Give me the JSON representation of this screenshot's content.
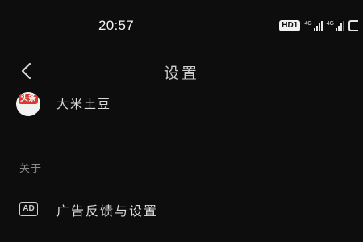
{
  "status_bar": {
    "time": "20:57",
    "hd_badge": "HD1",
    "network_1": "4G",
    "network_2": "4G"
  },
  "header": {
    "title": "设置",
    "back_icon": "chevron-left-icon"
  },
  "account": {
    "avatar_text": "头条",
    "name": "大米土豆"
  },
  "about_section": {
    "label": "关于"
  },
  "ad_row": {
    "icon_text": "AD",
    "label": "广告反馈与设置"
  },
  "colors": {
    "background": "#0d0d0d",
    "text": "#dcdcdc",
    "muted": "#8a8a8a",
    "avatar_red": "#d83a2e"
  }
}
